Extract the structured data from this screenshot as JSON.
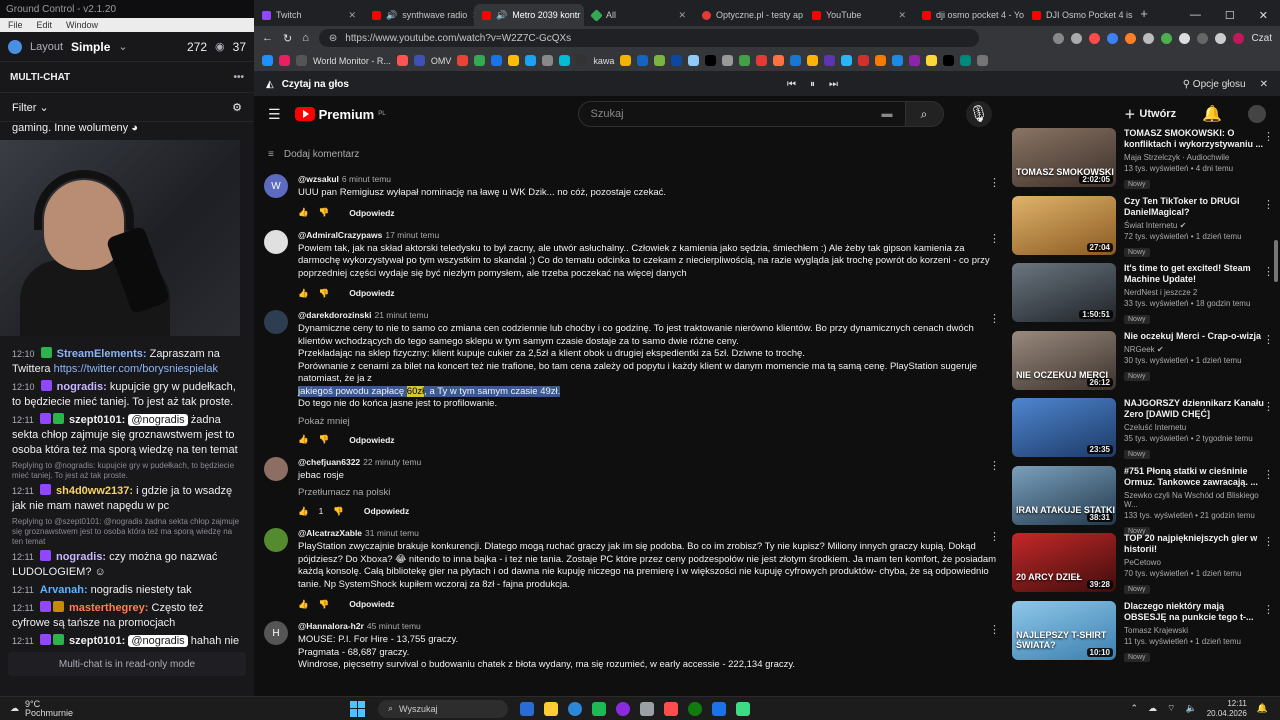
{
  "chat_app": {
    "title": "Ground Control - v2.1.20",
    "menu": [
      "File",
      "Edit",
      "Window"
    ],
    "layout_label": "Layout",
    "layout_value": "Simple",
    "viewers": "272",
    "viewers2": "37",
    "section": "MULTI-CHAT",
    "filter_label": "Filter",
    "readonly": "Multi-chat is in read-only mode",
    "messages": [
      {
        "kind": "text",
        "text": "gaming. Inne wolumeny"
      },
      {
        "kind": "msg",
        "time": "12:10",
        "user": "StreamElements:",
        "color": "#8ab4f8",
        "text": "Zapraszam na Twittera ",
        "link": "https://twitter.com/borysniespielak"
      },
      {
        "kind": "msg",
        "time": "12:10",
        "user": "nogradis:",
        "color": "#c9b6ff",
        "text": "kupujcie gry w pudełkach, to będziecie mieć taniej. To jest aż tak proste."
      },
      {
        "kind": "msg",
        "time": "12:11",
        "user": "szept0101:",
        "color": "#ffffff",
        "mention": "@nogradis",
        "text": "żadna sekta chłop zajmuje się groznawstwem jest to osoba która też ma sporą wiedzę na ten temat"
      },
      {
        "kind": "reply",
        "text": "Replying to @nogradis: kupujcie gry w pudełkach, to będziecie mieć taniej. To jest aż tak proste."
      },
      {
        "kind": "msg",
        "time": "12:11",
        "user": "sh4d0ww2137:",
        "color": "#f6d365",
        "text": "i gdzie ja to wsadzę jak nie mam nawet napędu w pc"
      },
      {
        "kind": "reply",
        "text": "Replying to @szept0101: @nogradis żadna sekta chłop zajmuje się groznawstwem jest to osoba która też ma sporą wiedzę na ten temat"
      },
      {
        "kind": "msg",
        "time": "12:11",
        "user": "nogradis:",
        "color": "#c9b6ff",
        "text": "czy można go nazwać LUDOLOGIEM?"
      },
      {
        "kind": "msg",
        "time": "12:11",
        "user": "Arvanah:",
        "color": "#5fb3ff",
        "text": "nogradis niestety tak"
      },
      {
        "kind": "msg",
        "time": "12:11",
        "user": "masterthegrey:",
        "color": "#ff7f50",
        "text": "Często też cyfrowe są tańsze na promocjach"
      },
      {
        "kind": "msg",
        "time": "12:11",
        "user": "szept0101:",
        "color": "#ffffff",
        "mention": "@nogradis",
        "text": "hahah nie"
      }
    ]
  },
  "browser": {
    "tabs": [
      {
        "label": "Twitch",
        "color": "#9146ff"
      },
      {
        "label": "synthwave radio",
        "color": "#ff0000"
      },
      {
        "label": "Metro 2039 kontr",
        "color": "#ff0000",
        "active": true
      },
      {
        "label": "All",
        "color": "#34a853"
      },
      {
        "label": "Optyczne.pl - testy ap",
        "color": "#e53935"
      },
      {
        "label": "YouTube",
        "color": "#ff0000"
      },
      {
        "label": "dji osmo pocket 4 - Yo",
        "color": "#ff0000"
      },
      {
        "label": "DJI Osmo Pocket 4 is h",
        "color": "#ff0000"
      }
    ],
    "url": "https://www.youtube.com/watch?v=W2Z7C-GcQXs",
    "bookmarks": [
      "World Monitor - R...",
      "OMV",
      "kawa"
    ],
    "read_aloud": "Czytaj na głos",
    "voice_options": "Opcje głosu",
    "profile_btn": "Czat"
  },
  "youtube": {
    "logo": "Premium",
    "logo_sup": "PL",
    "search_placeholder": "Szukaj",
    "create": "Utwórz",
    "add_comment": "Dodaj komentarz",
    "reply_label": "Odpowiedz",
    "comments": [
      {
        "author": "@wzsakul",
        "time": "6 minut temu",
        "avatar": "W",
        "avcolor": "#5c6bc0",
        "text": "UUU pan Remigiusz wyłapał nominację na ławę u WK Dzik... no cóż, pozostaje czekać."
      },
      {
        "author": "@AdmiralCrazypaws",
        "time": "17 minut temu",
        "avatar": "",
        "avcolor": "#e0e0e0",
        "text": "Powiem tak, jak na skład aktorski teledysku to był zacny, ale utwór asłuchalny.. Człowiek z kamienia jako sędzia, śmiechłem :) Ale żeby tak gipson kamienia za darmochę wykorzystywał po tym wszystkim to skandal ;) Co do tematu odcinka to czekam z niecierpliwością, na razie wygląda jak trochę powrót do korzeni - co przy poprzedniej części wydaje się być niezłym pomysłem, ale trzeba poczekać na więcej danych"
      },
      {
        "author": "@darekdorozinski",
        "time": "21 minut temu",
        "avatar": "",
        "avcolor": "#2c3e50",
        "text_a": "Dynamiczne ceny to nie to samo co zmiana cen codziennie lub choćby i co godzinę. To jest traktowanie nierówno klientów. Bo przy dynamicznych cenach dwóch klientów wchodzących do tego samego sklepu w tym samym czasie dostaje za to samo dwie różne ceny.",
        "text_b": "Przekładając na sklep fizyczny: klient kupuje cukier za 2,5zł a klient obok u drugiej ekspedientki za 5zł. Dziwne to trochę.",
        "text_c": "Porównanie z cenami za bilet na koncert też nie trafione, bo tam cena zależy od popytu i każdy klient w danym momencie ma tą samą cenę. PlayStation sugeruje natomiast, że ja z",
        "hl_a": "jakiegoś powodu zapłacę ",
        "hl_price": "60zł",
        "hl_b": ", a Ty w tym samym czasie 49zł.",
        "text_d": "Do tego nie do końca jasne jest to profilowanie.",
        "more": "Pokaż mniej"
      },
      {
        "author": "@chefjuan6322",
        "time": "22 minuty temu",
        "avatar": "",
        "avcolor": "#8d6e63",
        "text": "jebac rosje",
        "translate": "Przetłumacz na polski",
        "likes": "1"
      },
      {
        "author": "@AlcatrazXable",
        "time": "31 minut temu",
        "avatar": "",
        "avcolor": "#558b2f",
        "text": "PlayStation zwyczajnie brakuje konkurencji. Dlatego mogą ruchać graczy jak im się podoba. Bo co im zrobisz? Ty nie kupisz? Miliony innych graczy kupią. Dokąd pójdziesz? Do Xboxa? 😂 nitendo to inna bajka - i też nie tania. Zostaje PC które przez ceny podzespołów nie jest złotym środkiem. Ja mam ten komfort, że posiadam każdą konsolę. Całą bibliotekę gier na płytach i od dawna nie kupuję niczego na premierę i w większości nie kupuję cyfrowych produktów- chyba, że są odpowiednio tanie. Np SystemShock kupiłem wczoraj za 8zł - fajna produkcja."
      },
      {
        "author": "@Hannalora-h2r",
        "time": "45 minut temu",
        "avatar": "H",
        "avcolor": "#555",
        "lines": [
          "MOUSE: P.I. For Hire - 13,755 graczy.",
          "Pragmata - 68,687 graczy.",
          "Windrose, pięcsetny survival o budowaniu chatek z błota wydany, ma się rozumieć, w early accessie - 222,134 graczy."
        ]
      }
    ],
    "recommendations": [
      {
        "title": "TOMASZ SMOKOWSKI: O konfliktach i wykorzystywaniu ...",
        "channel": "Maja Strzelczyk · Audiochwile",
        "stats": "13 tys. wyświetleń • 4 dni temu",
        "dur": "2:02:05",
        "thumb": "#6d5a4e",
        "tt": "TOMASZ SMOKOWSKI"
      },
      {
        "title": "Czy Ten TikToker to DRUGI DanielMagical?",
        "channel": "Świat Internetu ✔",
        "stats": "72 tys. wyświetleń • 1 dzień temu",
        "dur": "27:04",
        "thumb": "#c98b3a",
        "tt": ""
      },
      {
        "title": "It's time to get excited! Steam Machine Update!",
        "channel": "NerdNest i jeszcze 2",
        "stats": "33 tys. wyświetleń • 18 godzin temu",
        "dur": "1:50:51",
        "thumb": "#4a5560",
        "tt": ""
      },
      {
        "title": "Nie oczekuj Merci - Crap-o-wizja",
        "channel": "NRGeek ✔",
        "stats": "30 tys. wyświetleń • 1 dzień temu",
        "dur": "26:12",
        "thumb": "#7a6a5f",
        "tt": "NIE OCZEKUJ MERCI"
      },
      {
        "title": "NAJGORSZY dziennikarz Kanału Zero [DAWID CHĘĆ]",
        "channel": "Czeluść Internetu",
        "stats": "35 tys. wyświetleń • 2 tygodnie temu",
        "dur": "23:35",
        "thumb": "#3e6fb0",
        "tt": ""
      },
      {
        "title": "#751 Płoną statki w cieśninie Ormuz. Tankowce zawracają. ...",
        "channel": "Szewko czyli Na Wschód od Bliskiego W...",
        "stats": "133 tys. wyświetleń • 21 godzin temu",
        "dur": "38:31",
        "thumb": "#4c6f8c",
        "tt": "IRAN ATAKUJE STATKI"
      },
      {
        "title": "TOP 20 najpiękniejszych gier w historii!",
        "channel": "PeCetowo",
        "stats": "70 tys. wyświetleń • 1 dzień temu",
        "dur": "39:28",
        "thumb": "#9b1b1b",
        "tt": "20 ARCY DZIEŁ"
      },
      {
        "title": "Dlaczego niektóry mają OBSESJĘ na punkcie tego t-...",
        "channel": "Tomasz Krajewski",
        "stats": "11 tys. wyświetleń • 1 dzień temu",
        "dur": "10:10",
        "thumb": "#5fa8d3",
        "tt": "NAJLEPSZY T-SHIRT ŚWIATA?"
      }
    ],
    "badge_new": "Nowy"
  },
  "taskbar": {
    "temp": "9°C",
    "weather": "Pochmurnie",
    "search": "Wyszukaj",
    "time": "12:11",
    "date": "20.04.2026",
    "apps": [
      "#2a6cd6",
      "#ffcc33",
      "#2b88d8",
      "#1db954",
      "#8a2be2",
      "#9aa0a6",
      "#ff4d4d",
      "#107c10",
      "#1a73e8",
      "#3ddc84"
    ]
  }
}
